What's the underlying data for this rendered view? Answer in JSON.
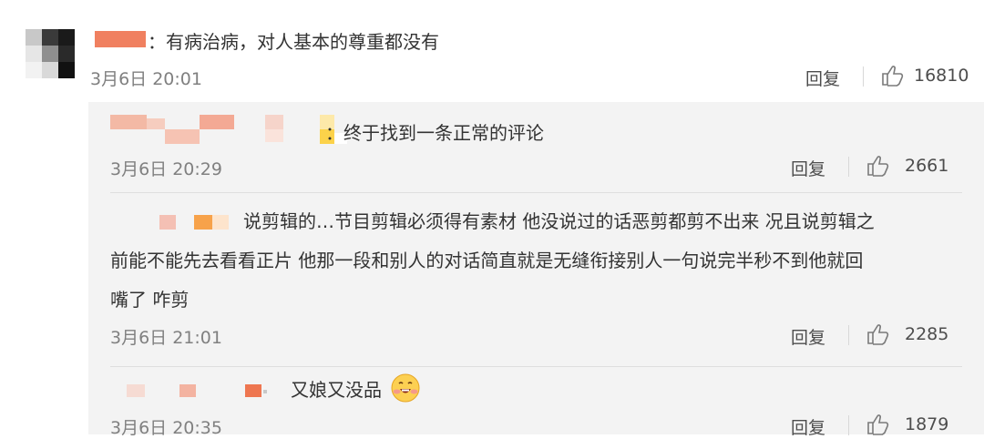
{
  "main_comment": {
    "text": "：有病治病，对人基本的尊重都没有",
    "timestamp": "3月6日 20:01",
    "reply_label": "回复",
    "likes": "16810"
  },
  "replies": [
    {
      "text": "：终于找到一条正常的评论",
      "timestamp": "3月6日 20:29",
      "reply_label": "回复",
      "likes": "2661"
    },
    {
      "text_line1": "说剪辑的…节目剪辑必须得有素材 他没说过的话恶剪都剪不出来 况且说剪辑之",
      "text_line2": "前能不能先去看看正片 他那一段和别人的对话简直就是无缝衔接别人一句说完半秒不到他就回",
      "text_line3": "嘴了 咋剪",
      "timestamp": "3月6日 21:01",
      "reply_label": "回复",
      "likes": "2285"
    },
    {
      "text": "又娘又没品",
      "timestamp": "3月6日 20:35",
      "reply_label": "回复",
      "likes": "1879"
    }
  ],
  "icons": {
    "like": "thumbs-up-icon",
    "emoji": "grinning-blush-emoji-icon"
  },
  "colors": {
    "username_redaction": "#f08060",
    "meta_text": "#808080",
    "reply_panel_bg": "#f3f3f3"
  }
}
